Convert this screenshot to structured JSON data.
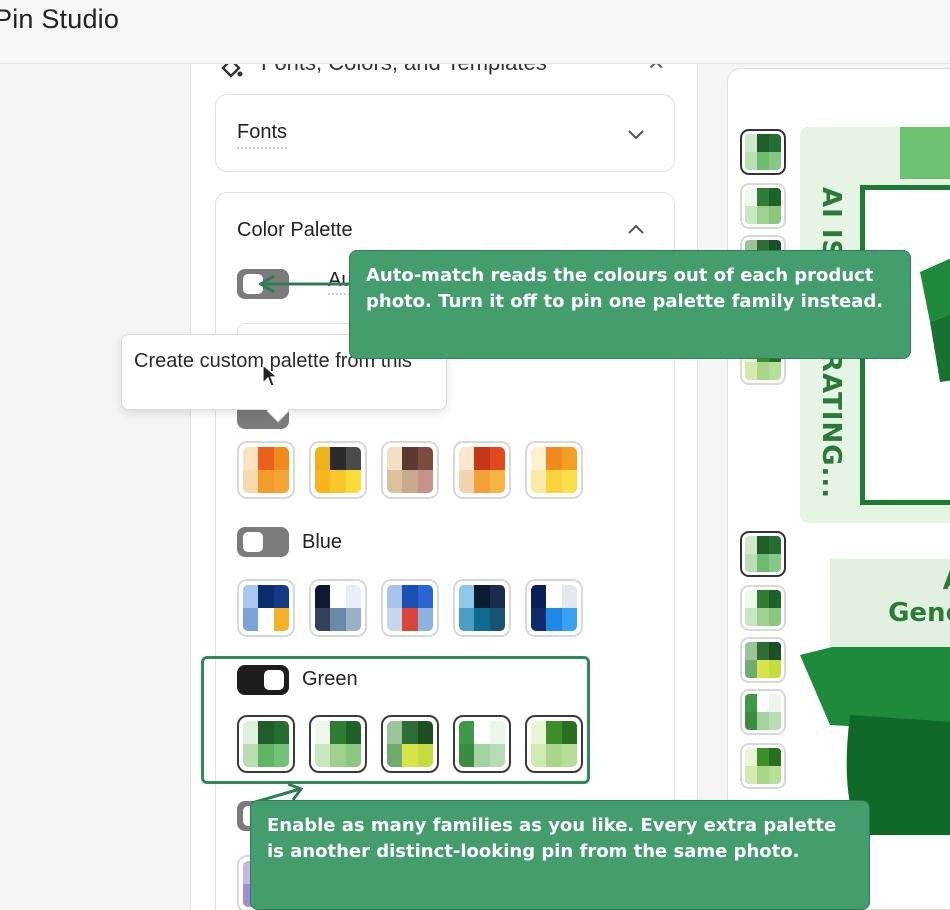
{
  "app": {
    "title": "Pin Studio"
  },
  "panel": {
    "header_title": "Fonts, Colors, and Templates",
    "header_icon": "paint-bucket-icon",
    "fonts_section": {
      "label": "Fonts",
      "state": "collapsed",
      "icon": "chevron-down-icon"
    },
    "color_palette": {
      "label": "Color Palette",
      "state": "expanded",
      "icon": "chevron-up-icon",
      "auto_match": {
        "label": "Auto-match",
        "enabled": false
      },
      "tooltip": "Create custom palette from this",
      "families": [
        {
          "name": "",
          "enabled": false,
          "swatches": [
            [
              "#fbe3c2",
              "#e8601c",
              "#f08a1c",
              "#f6d9ad",
              "#f29a2a",
              "#f4a432"
            ],
            [
              "#f0b21c",
              "#2b2b2b",
              "#4a4a4a",
              "#f5b51e",
              "#f7c72c",
              "#fadb3c"
            ],
            [
              "#f3dfc4",
              "#5c3a32",
              "#7a4b3f",
              "#dcc19f",
              "#c9a98b",
              "#c5928b"
            ],
            [
              "#fbe7d0",
              "#c8361a",
              "#e24a1e",
              "#f3d2b2",
              "#f2a13a",
              "#f7b446"
            ],
            [
              "#fdf1cf",
              "#f08a1c",
              "#f39e24",
              "#fbe9a8",
              "#f7d23a",
              "#f9e04a"
            ]
          ]
        },
        {
          "name": "Blue",
          "enabled": false,
          "swatches": [
            [
              "#a7c8ef",
              "#0b2d6b",
              "#143a85",
              "#7aa3d8",
              "#ffffff",
              "#f3b22a"
            ],
            [
              "#0e1a33",
              "#ffffff",
              "#e9eef6",
              "#33425c",
              "#6c87a8",
              "#9ab0c9"
            ],
            [
              "#a6c3ea",
              "#1c4fb4",
              "#2a66cf",
              "#c8d6ec",
              "#d8453a",
              "#8db2de"
            ],
            [
              "#8dc7e6",
              "#0d1b33",
              "#1b2c4a",
              "#4a9ec4",
              "#0f6b8f",
              "#17546e"
            ],
            [
              "#0a1f55",
              "#ffffff",
              "#e3e8ef",
              "#0f2b6e",
              "#1e88e5",
              "#3aa0f0"
            ]
          ]
        },
        {
          "name": "Green",
          "enabled": true,
          "swatches": [
            [
              "#dff1dc",
              "#1d5e2b",
              "#256d33",
              "#b8deb2",
              "#5fb564",
              "#72c377"
            ],
            [
              "#eef7e9",
              "#2f7d34",
              "#1f6228",
              "#c8e6c0",
              "#9bd08e",
              "#8bc77d"
            ],
            [
              "#9bc49a",
              "#2c6e35",
              "#1d4f25",
              "#6faa6e",
              "#d6e44a",
              "#c4dc3e"
            ],
            [
              "#3f9a47",
              "#ffffff",
              "#eef5ee",
              "#3b8c43",
              "#a4d29e",
              "#b8dcb3"
            ],
            [
              "#eaf5d4",
              "#3d8f2a",
              "#2a6e20",
              "#d2e9b0",
              "#a8d68a",
              "#b7de97"
            ]
          ]
        },
        {
          "name": "",
          "enabled": false,
          "swatches": []
        }
      ]
    }
  },
  "preview": {
    "pin1_text": "AI IS GENERATING...",
    "pin2_text": "AI is Generat",
    "mini_swatches": [
      [
        "#cfe8ca",
        "#1d5e2b",
        "#256d33",
        "#b8deb2",
        "#6cbc6f",
        "#86c987"
      ],
      [
        "#eef7e9",
        "#2f7d34",
        "#1f6228",
        "#c8e6c0",
        "#9bd08e",
        "#8bc77d"
      ],
      [
        "#9bc49a",
        "#2c6e35",
        "#1d4f25",
        "#6faa6e",
        "#d6e44a",
        "#c4dc3e"
      ],
      [
        "#dff1dc",
        "#1d5e2b",
        "#256d33",
        "#b8deb2",
        "#5fb564",
        "#72c377"
      ],
      [
        "#eaf5d4",
        "#3d8f2a",
        "#2a6e20",
        "#d2e9b0",
        "#a8d68a",
        "#b7de97"
      ],
      [
        "#cfe8ca",
        "#1d5e2b",
        "#256d33",
        "#b8deb2",
        "#6cbc6f",
        "#86c987"
      ],
      [
        "#eef7e9",
        "#2f7d34",
        "#1f6228",
        "#c8e6c0",
        "#9bd08e",
        "#8bc77d"
      ],
      [
        "#9bc49a",
        "#2c6e35",
        "#1d4f25",
        "#6faa6e",
        "#d6e44a",
        "#c4dc3e"
      ],
      [
        "#3f9a47",
        "#ffffff",
        "#eef5ee",
        "#3b8c43",
        "#a4d29e",
        "#b8dcb3"
      ],
      [
        "#eaf5d4",
        "#3d8f2a",
        "#2a6e20",
        "#d2e9b0",
        "#a8d68a",
        "#b7de97"
      ]
    ]
  },
  "annotations": {
    "callout_1": "Auto-match reads the colours out of each product photo. Turn it off to pin one palette family instead.",
    "callout_2": "Enable as many families as you like. Every extra palette is another distinct-looking pin from the same photo.",
    "accent_color": "#439d6c"
  }
}
